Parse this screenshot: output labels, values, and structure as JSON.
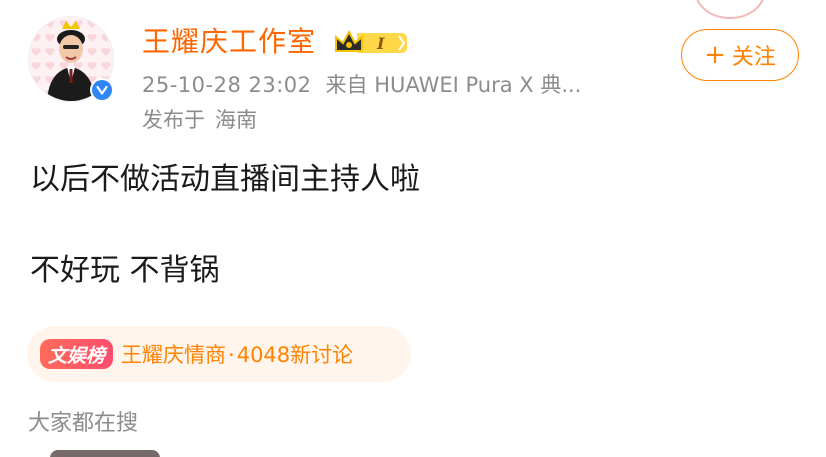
{
  "author": {
    "name": "王耀庆工作室",
    "vip_level": "I",
    "verified": true
  },
  "post_meta": {
    "timestamp": "25-10-28 23:02",
    "source": "来自 HUAWEI Pura X 典...",
    "location_label": "发布于",
    "location": "海南"
  },
  "follow_button": {
    "plus": "+",
    "label": "关注"
  },
  "content": {
    "line1": "以后不做活动直播间主持人啦",
    "line2": "不好玩 不背锅"
  },
  "topic": {
    "tag": "文娱榜",
    "title": "王耀庆情商",
    "separator": "·",
    "stat": "4048新讨论"
  },
  "search_hint": "大家都在搜",
  "colors": {
    "accent": "#ff8200",
    "name": "#ff6600",
    "meta": "#8c8c8c",
    "verified": "#2f86f6",
    "chip_bg": "#fff5ec"
  }
}
